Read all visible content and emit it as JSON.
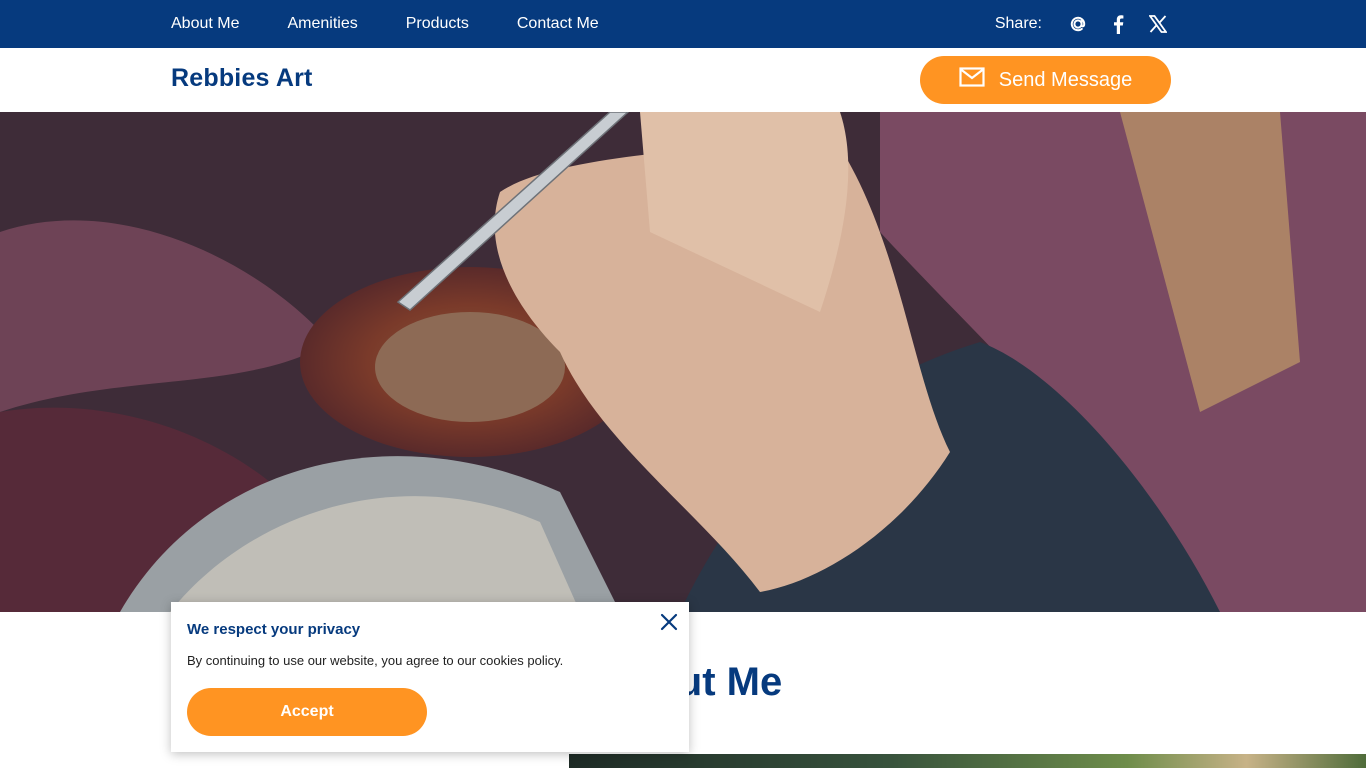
{
  "nav": {
    "items": [
      {
        "label": "About Me"
      },
      {
        "label": "Amenities"
      },
      {
        "label": "Products"
      },
      {
        "label": "Contact Me"
      }
    ],
    "share_label": "Share:",
    "share_icons": [
      "at-icon",
      "facebook-icon",
      "x-icon"
    ]
  },
  "header": {
    "brand": "Rebbies Art",
    "send_button_label": "Send Message"
  },
  "section": {
    "title": "About Me"
  },
  "cookie": {
    "title": "We respect your privacy",
    "text": "By continuing to use our website, you agree to our cookies policy.",
    "accept_label": "Accept"
  },
  "colors": {
    "nav_bg": "#063a7e",
    "accent": "#ff9422",
    "brand": "#063a7e"
  }
}
